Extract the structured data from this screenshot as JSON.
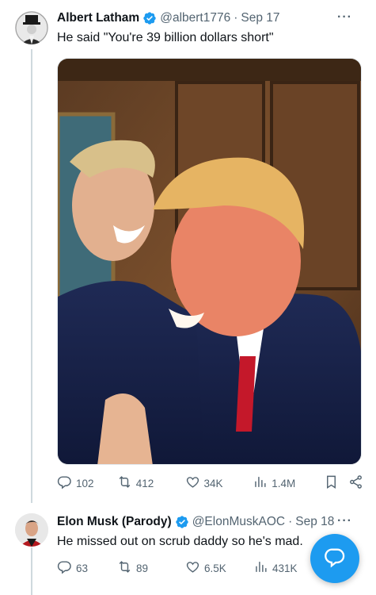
{
  "tweets": [
    {
      "author_name": "Albert Latham",
      "handle": "@albert1776",
      "separator": "·",
      "date": "Sep 17",
      "more": "···",
      "text": "He said \"You're 39 billion dollars short\"",
      "stats": {
        "replies": "102",
        "retweets": "412",
        "likes": "34K",
        "views": "1.4M"
      }
    },
    {
      "author_name": "Elon Musk (Parody)",
      "handle": "@ElonMuskAOC",
      "separator": "·",
      "date": "Sep 18",
      "more": "···",
      "text": "He missed out on scrub daddy so he's mad.",
      "stats": {
        "replies": "63",
        "retweets": "89",
        "likes": "6.5K",
        "views": "431K"
      }
    }
  ],
  "icons": {
    "verified": "verified-badge-icon",
    "reply": "reply-icon",
    "retweet": "retweet-icon",
    "like": "heart-icon",
    "views": "views-icon",
    "bookmark": "bookmark-icon",
    "share": "share-icon",
    "compose": "compose-reply-icon"
  },
  "colors": {
    "accent": "#1d9bf0",
    "text_primary": "#0f1419",
    "text_secondary": "#536471",
    "thread_line": "#cfd9de"
  }
}
